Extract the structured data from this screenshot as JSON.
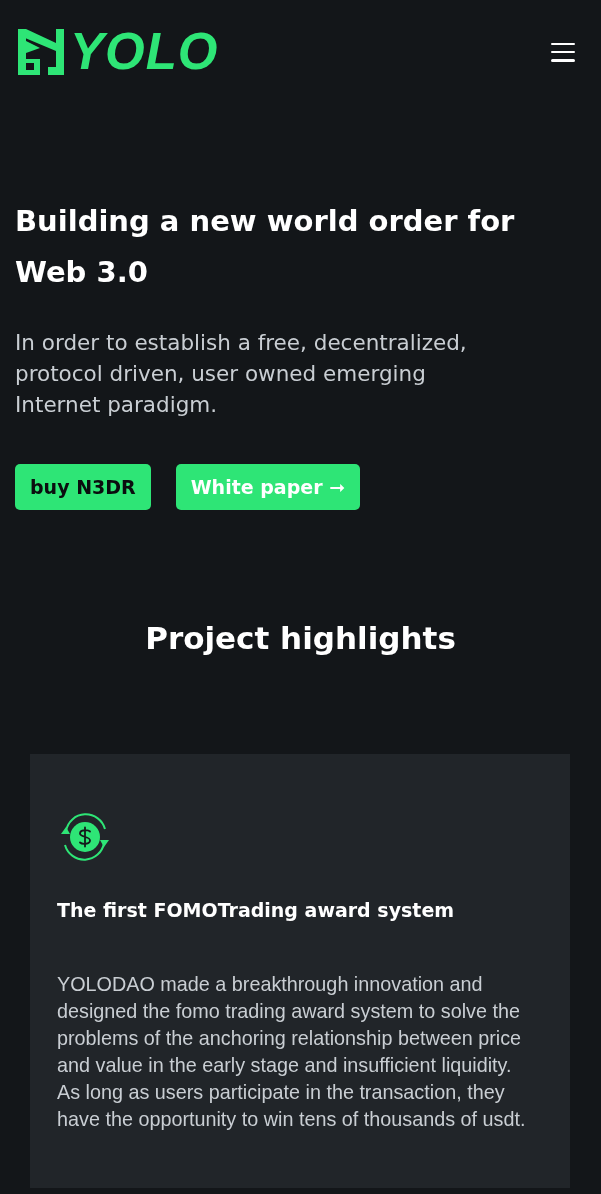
{
  "header": {
    "logo_text": "YOLO"
  },
  "hero": {
    "title": "Building a new world order for Web 3.0",
    "subtitle": "In order to establish a free, decentralized, protocol driven, user owned emerging Internet paradigm.",
    "buttons": [
      {
        "label": "buy N3DR",
        "kind": "dark"
      },
      {
        "label": "White paper ➞",
        "kind": "light"
      }
    ]
  },
  "highlights": {
    "title": "Project highlights",
    "cards": [
      {
        "kind": "money",
        "title": "The first FOMOTrading award system",
        "body": "YOLODAO made a breakthrough innovation and designed the fomo trading award system to solve the problems of the anchoring relationship between price and value in the early stage and insufficient liquidity. As long as users participate in the transaction, they have the opportunity to win tens of thousands of usdt."
      }
    ]
  }
}
